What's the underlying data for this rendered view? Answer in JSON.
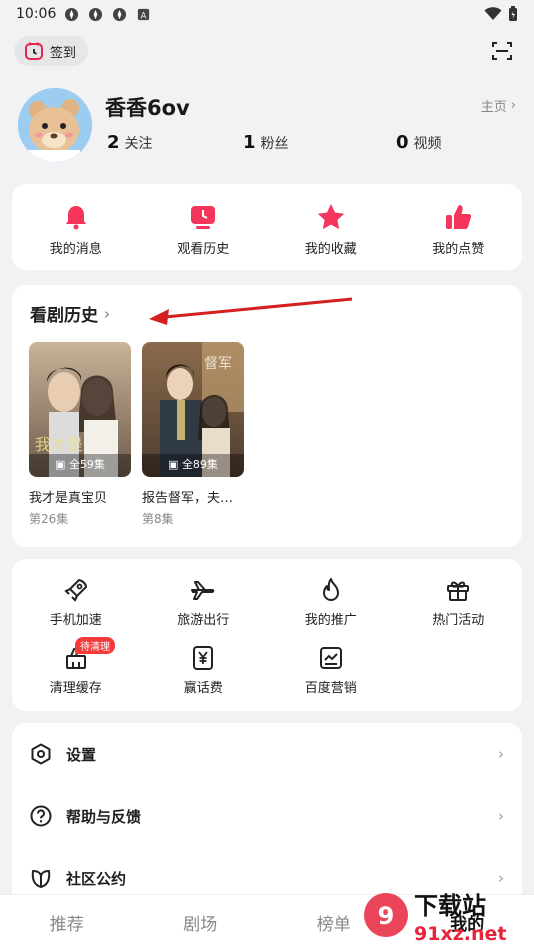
{
  "status": {
    "time": "10:06"
  },
  "top": {
    "checkin_label": "签到"
  },
  "profile": {
    "name": "香香6ov",
    "home_link": "主页",
    "stats": [
      {
        "value": "2",
        "label": "关注"
      },
      {
        "value": "1",
        "label": "粉丝"
      },
      {
        "value": "0",
        "label": "视频"
      }
    ]
  },
  "quick_actions": [
    {
      "label": "我的消息",
      "icon": "bell-icon"
    },
    {
      "label": "观看历史",
      "icon": "tv-clock-icon"
    },
    {
      "label": "我的收藏",
      "icon": "star-icon"
    },
    {
      "label": "我的点赞",
      "icon": "thumb-up-icon"
    }
  ],
  "history": {
    "title": "看剧历史",
    "items": [
      {
        "title": "我才是真宝贝",
        "episode": "第26集",
        "badge": "全59集"
      },
      {
        "title": "报告督军，夫…",
        "episode": "第8集",
        "badge": "全89集"
      }
    ]
  },
  "services": [
    {
      "label": "手机加速",
      "icon": "rocket-icon"
    },
    {
      "label": "旅游出行",
      "icon": "plane-icon"
    },
    {
      "label": "我的推广",
      "icon": "flame-icon"
    },
    {
      "label": "热门活动",
      "icon": "gift-icon"
    },
    {
      "label": "清理缓存",
      "icon": "broom-icon",
      "tag": "待清理"
    },
    {
      "label": "赢话费",
      "icon": "yen-card-icon"
    },
    {
      "label": "百度营销",
      "icon": "chart-card-icon"
    }
  ],
  "menu": [
    {
      "label": "设置",
      "icon": "settings-icon"
    },
    {
      "label": "帮助与反馈",
      "icon": "help-icon"
    },
    {
      "label": "社区公约",
      "icon": "leaf-icon"
    }
  ],
  "tabs": [
    "推荐",
    "剧场",
    "榜单",
    "我的"
  ],
  "watermark": {
    "text1": "下载站",
    "text2": "91xz.net"
  },
  "colors": {
    "accent": "#f5365c",
    "background": "#f2f2f4",
    "tag": "#f53a3a"
  }
}
